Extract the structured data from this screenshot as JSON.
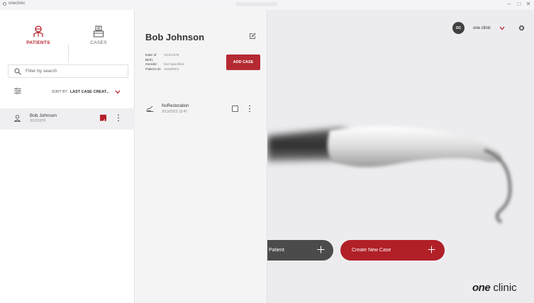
{
  "window": {
    "title": "oneclinic",
    "controls": [
      "–",
      "□",
      "✕"
    ]
  },
  "nav": {
    "tabs": [
      {
        "label": "PATIENTS",
        "icon": "patient-icon",
        "active": true
      },
      {
        "label": "CASES",
        "icon": "cases-icon",
        "active": false
      }
    ]
  },
  "search": {
    "placeholder": "Filter by search",
    "value": ""
  },
  "sort": {
    "prefix": "SORT BY:",
    "value": "LAST CASE CREAT..."
  },
  "patients": [
    {
      "name": "Bob Johnson",
      "date": "3/13/1976",
      "checked": true
    }
  ],
  "detail": {
    "name": "Bob Johnson",
    "fields": [
      {
        "key": "Date of Birth:",
        "value": "3/13/1976"
      },
      {
        "key": "Gender:",
        "value": "Not Specified"
      },
      {
        "key": "Patient ID:",
        "value": "10000001"
      }
    ],
    "add_case_label": "ADD CASE",
    "cases": [
      {
        "name": "NoRestoration",
        "date": "3/13/2023 13:47",
        "checked": false
      }
    ]
  },
  "header": {
    "avatar_initials": "OC",
    "clinic_name": "one clinic"
  },
  "actions": {
    "new_patient_label": "Patient",
    "new_case_label": "Create New Case"
  },
  "brand": {
    "prefix": "one",
    "suffix": " clinic"
  },
  "colors": {
    "accent": "#b4202a",
    "dark_pill": "#4b4b4b"
  }
}
